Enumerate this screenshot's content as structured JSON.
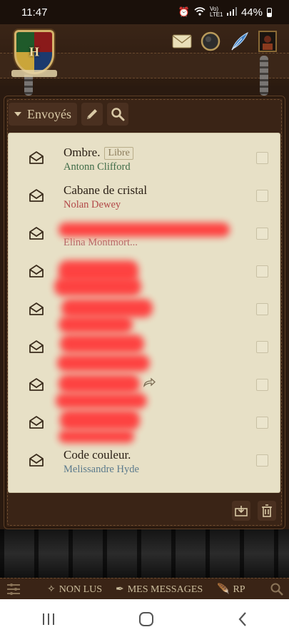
{
  "status_bar": {
    "time": "11:47",
    "battery": "44%",
    "network": "Vo) LTE1"
  },
  "toolbar": {
    "folder": "Envoyés"
  },
  "messages": [
    {
      "title": "Ombre.",
      "tag": "Libre",
      "author": "Antonn Clifford",
      "author_color": "#3e6b47",
      "redacted": false
    },
    {
      "title": "Cabane de cristal",
      "tag": "",
      "author": "Nolan Dewey",
      "author_color": "#b24848",
      "redacted": false
    },
    {
      "title": "",
      "tag": "",
      "author": "Elina Montmort...",
      "author_color": "#b46a6a",
      "redacted": true
    },
    {
      "title": "",
      "tag": "",
      "author": "",
      "author_color": "",
      "redacted": true
    },
    {
      "title": "",
      "tag": "",
      "author": "",
      "author_color": "",
      "redacted": true
    },
    {
      "title": "",
      "tag": "",
      "author": "",
      "author_color": "",
      "redacted": true
    },
    {
      "title": "",
      "tag": "",
      "author": "",
      "author_color": "",
      "redacted": true
    },
    {
      "title": "",
      "tag": "",
      "author": "",
      "author_color": "",
      "redacted": true
    },
    {
      "title": "Code couleur.",
      "tag": "",
      "author": "Melissandre Hyde",
      "author_color": "#5b7a8c",
      "redacted": false
    }
  ],
  "bottom_nav": {
    "unread": "NON LUS",
    "my_messages": "MES MESSAGES",
    "rp": "RP"
  },
  "colors": {
    "leather": "#3a2416",
    "parchment": "#e7e0c6",
    "redaction": "#ff3b3b"
  }
}
